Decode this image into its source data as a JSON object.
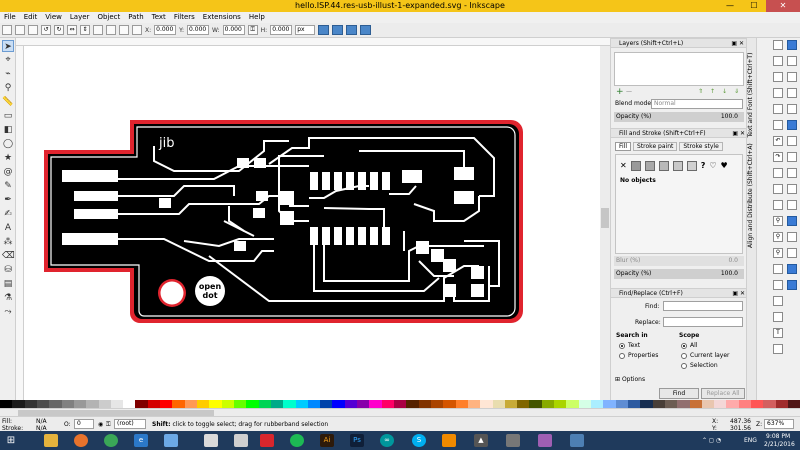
{
  "window": {
    "title": "hello.ISP.44.res-usb-illust-1-expanded.svg - Inkscape",
    "minimize": "—",
    "maximize": "☐",
    "close": "✕"
  },
  "menu": [
    "File",
    "Edit",
    "View",
    "Layer",
    "Object",
    "Path",
    "Text",
    "Filters",
    "Extensions",
    "Help"
  ],
  "toolbar": {
    "x_label": "X:",
    "x_value": "0.000",
    "y_label": "Y:",
    "y_value": "0.000",
    "w_label": "W:",
    "w_value": "0.000",
    "h_label": "H:",
    "h_value": "0.000",
    "unit": "px"
  },
  "artwork": {
    "board_label": "jib",
    "logo_line1": "open",
    "logo_line2": "dot"
  },
  "layers_panel": {
    "title": "Layers (Shift+Ctrl+L)",
    "blend_label": "Blend mode:",
    "blend_value": "Normal",
    "opacity_label": "Opacity (%)",
    "opacity_value": "100.0"
  },
  "fill_stroke_panel": {
    "title": "Fill and Stroke (Shift+Ctrl+F)",
    "tabs": [
      "Fill",
      "Stroke paint",
      "Stroke style"
    ],
    "status": "No objects",
    "blur_label": "Blur (%)",
    "blur_value": "0.0",
    "opacity_label": "Opacity (%)",
    "opacity_value": "100.0"
  },
  "find_panel": {
    "title": "Find/Replace (Ctrl+F)",
    "find_label": "Find:",
    "replace_label": "Replace:",
    "search_in_label": "Search in",
    "search_text": "Text",
    "search_properties": "Properties",
    "scope_label": "Scope",
    "scope_all": "All",
    "scope_layer": "Current layer",
    "scope_selection": "Selection",
    "options_label": "Options",
    "find_button": "Find",
    "replace_all_button": "Replace All"
  },
  "side_tab": {
    "label": "Align and Distribute (Shift+Ctrl+A)",
    "label2": "Text and Font (Shift+Ctrl+T)"
  },
  "status": {
    "fill_label": "Fill:",
    "fill_value": "N/A",
    "stroke_label": "Stroke:",
    "stroke_value": "N/A",
    "o_label": "O:",
    "o_value": "0",
    "layer_value": "(root)",
    "message_bold": "Shift:",
    "message": " click to toggle select; drag for rubberband selection",
    "x_label": "X:",
    "x_value": "487.36",
    "y_label": "Y:",
    "y_value": "301.56",
    "z_label": "Z:",
    "zoom_value": "637%"
  },
  "taskbar": {
    "lang": "ENG",
    "time": "9:08 PM",
    "date": "2/21/2016"
  },
  "colors": {
    "accent_title": "#f5c518",
    "board": "#000000",
    "board_outline": "#e0242e",
    "traces": "#ffffff"
  },
  "taskbar_icons": [
    "windows-icon",
    "folder-icon",
    "firefox-icon",
    "chrome-icon",
    "explorer-icon",
    "notepad-icon",
    "acrobat-icon",
    "spotify-icon",
    "illustrator-icon",
    "photoshop-icon",
    "arduino-icon",
    "skype-icon",
    "vlc-icon",
    "inkscape-icon",
    "gimp-icon",
    "fritzing-icon",
    "window-icon"
  ]
}
